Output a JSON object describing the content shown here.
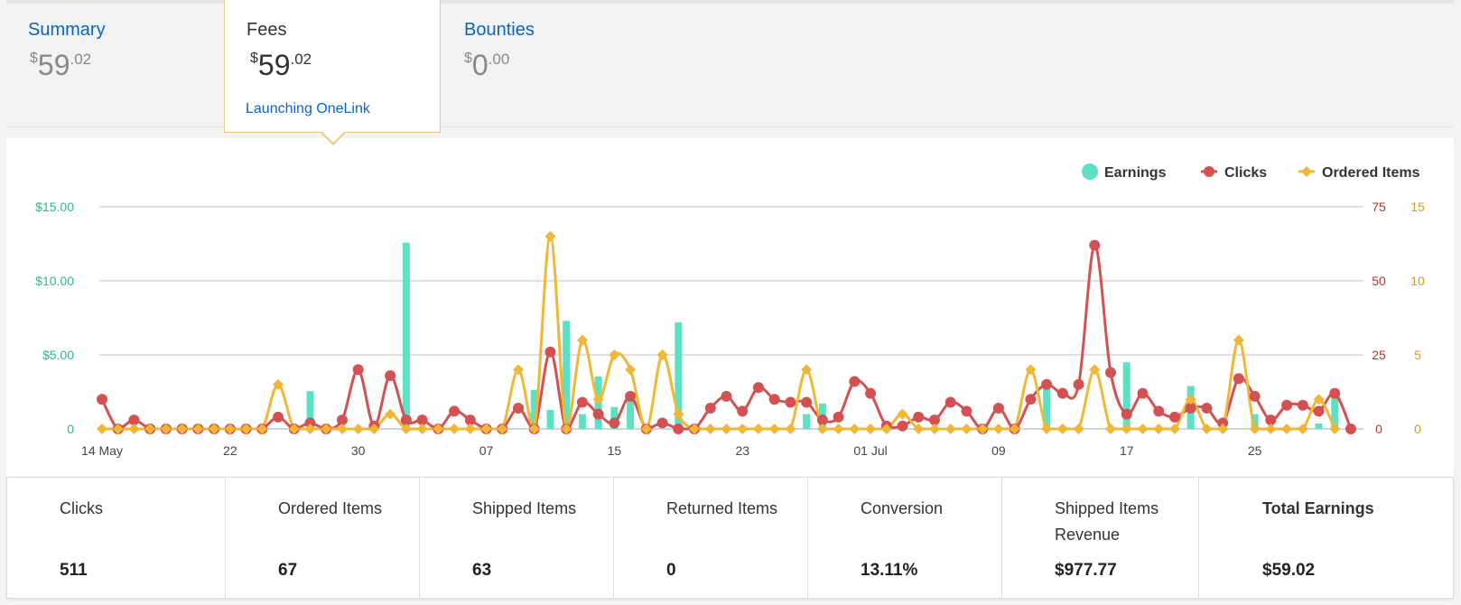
{
  "tabs": [
    {
      "label": "Summary",
      "currency": "$",
      "whole": "59",
      "fraction": ".02"
    },
    {
      "label": "Fees",
      "currency": "$",
      "whole": "59",
      "fraction": ".02",
      "link": "Launching OneLink",
      "selected": true
    },
    {
      "label": "Bounties",
      "currency": "$",
      "whole": "0",
      "fraction": ".00"
    }
  ],
  "colors": {
    "earnings": "#5ce1c4",
    "clicks": "#d35152",
    "ordered_items": "#f0b636",
    "link": "#0b63c4"
  },
  "chart_data": {
    "type": "bar+line",
    "legend": {
      "position": "top-right",
      "entries": [
        "Earnings",
        "Clicks",
        "Ordered Items"
      ]
    },
    "grid": true,
    "x_ticks": [
      {
        "label": "14 May",
        "index": 0
      },
      {
        "label": "22",
        "index": 8
      },
      {
        "label": "30",
        "index": 16
      },
      {
        "label": "07",
        "index": 24
      },
      {
        "label": "15",
        "index": 32
      },
      {
        "label": "23",
        "index": 40
      },
      {
        "label": "01 Jul",
        "index": 48
      },
      {
        "label": "09",
        "index": 56
      },
      {
        "label": "17",
        "index": 64
      },
      {
        "label": "25",
        "index": 72
      }
    ],
    "y_left": {
      "ticks": [
        "0",
        "$5.00",
        "$10.00",
        "$15.00"
      ],
      "range": [
        0,
        15
      ]
    },
    "y_right_clicks": {
      "ticks": [
        "0",
        "25",
        "50",
        "75"
      ],
      "range": [
        0,
        75
      ]
    },
    "y_right_items": {
      "ticks": [
        "0",
        "5",
        "10",
        "15"
      ],
      "range": [
        0,
        15
      ]
    },
    "series": [
      {
        "name": "Earnings",
        "type": "bar",
        "axis": "left",
        "values": [
          0,
          0,
          0,
          0,
          0,
          0,
          0,
          0,
          0,
          0,
          0,
          0,
          0,
          2.55,
          0,
          0,
          0,
          0,
          0,
          12.58,
          0,
          0,
          0,
          0,
          0,
          0,
          0,
          2.64,
          1.28,
          7.3,
          1.0,
          3.55,
          1.48,
          2.5,
          0,
          0,
          7.2,
          0,
          0,
          0,
          0,
          0,
          0,
          0,
          1.0,
          1.72,
          0,
          0,
          0,
          0,
          0,
          0,
          0,
          0,
          0,
          0,
          0,
          0,
          0,
          3.0,
          0,
          0,
          0,
          0,
          4.5,
          0,
          0,
          0,
          2.9,
          0,
          0,
          0,
          1.0,
          0,
          0,
          0,
          0.37,
          2.45
        ]
      },
      {
        "name": "Clicks",
        "type": "line",
        "axis": "right_clicks",
        "values": [
          10,
          0,
          3,
          0,
          0,
          0,
          0,
          0,
          0,
          0,
          0,
          4,
          0,
          2,
          0,
          3,
          20,
          1,
          18,
          3,
          3,
          0,
          6,
          3,
          0,
          0,
          7,
          0,
          26,
          0,
          9,
          5,
          2,
          11,
          0,
          2,
          0,
          0,
          7,
          11,
          6,
          14,
          10,
          9,
          9,
          3,
          4,
          16,
          12,
          1,
          1,
          4,
          3,
          9,
          6,
          0,
          7,
          0,
          10,
          15,
          12,
          15,
          62,
          19,
          5,
          12,
          6,
          4,
          7,
          7,
          2,
          17,
          11,
          3,
          8,
          8,
          6,
          12,
          0
        ]
      },
      {
        "name": "Ordered Items",
        "type": "line",
        "axis": "right_items",
        "values": [
          0,
          0,
          0,
          0,
          0,
          0,
          0,
          0,
          0,
          0,
          0,
          3,
          0,
          0,
          0,
          0,
          0,
          0,
          1,
          0,
          0,
          0,
          0,
          0,
          0,
          0,
          4,
          0,
          13,
          0,
          6,
          2,
          5,
          4,
          0,
          5,
          1,
          0,
          0,
          0,
          0,
          0,
          0,
          0,
          4,
          0,
          0,
          0,
          0,
          0,
          1,
          0,
          0,
          0,
          0,
          0,
          0,
          0,
          4,
          0,
          0,
          0,
          4,
          0,
          0,
          0,
          0,
          0,
          2,
          0,
          0,
          6,
          0,
          0,
          0,
          0,
          2,
          0
        ]
      }
    ]
  },
  "stats": [
    {
      "label": "Clicks",
      "value": "511"
    },
    {
      "label": "Ordered Items",
      "value": "67"
    },
    {
      "label": "Shipped Items",
      "value": "63"
    },
    {
      "label": "Returned Items",
      "value": "0"
    },
    {
      "label": "Conversion",
      "value": "13.11%"
    },
    {
      "label": "Shipped Items Revenue",
      "value": "$977.77"
    },
    {
      "label": "Total Earnings",
      "value": "$59.02"
    }
  ]
}
